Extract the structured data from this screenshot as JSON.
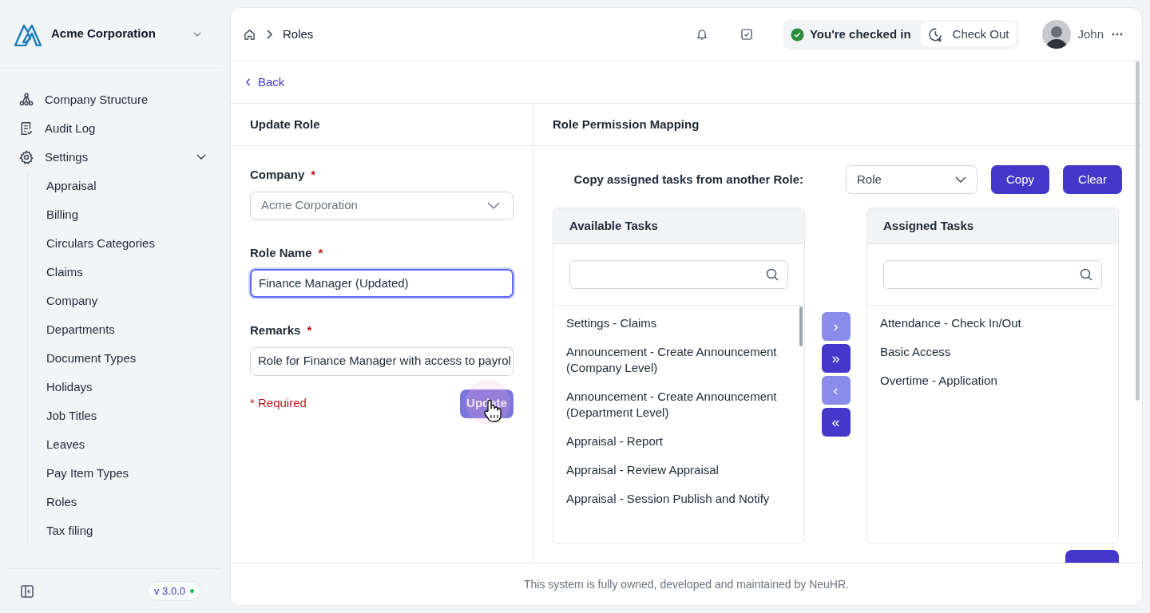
{
  "sidebar": {
    "company": "Acme Corporation",
    "items": [
      {
        "label": "Company Structure"
      },
      {
        "label": "Audit Log"
      },
      {
        "label": "Settings",
        "expanded": true,
        "children": [
          {
            "label": "Appraisal"
          },
          {
            "label": "Billing"
          },
          {
            "label": "Circulars Categories"
          },
          {
            "label": "Claims"
          },
          {
            "label": "Company"
          },
          {
            "label": "Departments"
          },
          {
            "label": "Document Types"
          },
          {
            "label": "Holidays"
          },
          {
            "label": "Job Titles"
          },
          {
            "label": "Leaves"
          },
          {
            "label": "Pay Item Types"
          },
          {
            "label": "Roles"
          },
          {
            "label": "Tax filing"
          }
        ]
      }
    ],
    "version": "v 3.0.0"
  },
  "header": {
    "breadcrumb": "Roles",
    "check_status": "You're checked in",
    "check_button": "Check Out",
    "user": "John"
  },
  "back": "Back",
  "update_role": {
    "title": "Update Role",
    "fields": [
      {
        "label": "Company",
        "required_mark": "*",
        "value": "Acme Corporation",
        "kind": "select",
        "disabled": true,
        "focused": false
      },
      {
        "label": "Role Name",
        "required_mark": "*",
        "value": "Finance Manager (Updated)",
        "kind": "text",
        "disabled": false,
        "focused": true
      },
      {
        "label": "Remarks",
        "required_mark": "*",
        "value": "Role for Finance Manager with access to payrol",
        "kind": "text",
        "disabled": false,
        "focused": false
      }
    ],
    "required_note": "* Required",
    "submit": "Update"
  },
  "mapping": {
    "title": "Role Permission Mapping",
    "copy_label": "Copy assigned tasks from another Role:",
    "role_select": "Role",
    "copy_button": "Copy",
    "clear_button": "Clear",
    "available": {
      "title": "Available Tasks",
      "tasks": [
        "Settings - Claims",
        "Announcement - Create Announcement (Company Level)",
        "Announcement - Create Announcement (Department Level)",
        "Appraisal - Report",
        "Appraisal - Review Appraisal",
        "Appraisal - Session Publish and Notify"
      ]
    },
    "transfer_buttons": [
      {
        "label": "›",
        "disabled": true
      },
      {
        "label": "»",
        "disabled": false
      },
      {
        "label": "‹",
        "disabled": true
      },
      {
        "label": "«",
        "disabled": false
      }
    ],
    "assigned": {
      "title": "Assigned Tasks",
      "tasks": [
        "Attendance - Check In/Out",
        "Basic Access",
        "Overtime - Application"
      ]
    }
  },
  "footer": "This system is fully owned, developed and maintained by NeuHR."
}
